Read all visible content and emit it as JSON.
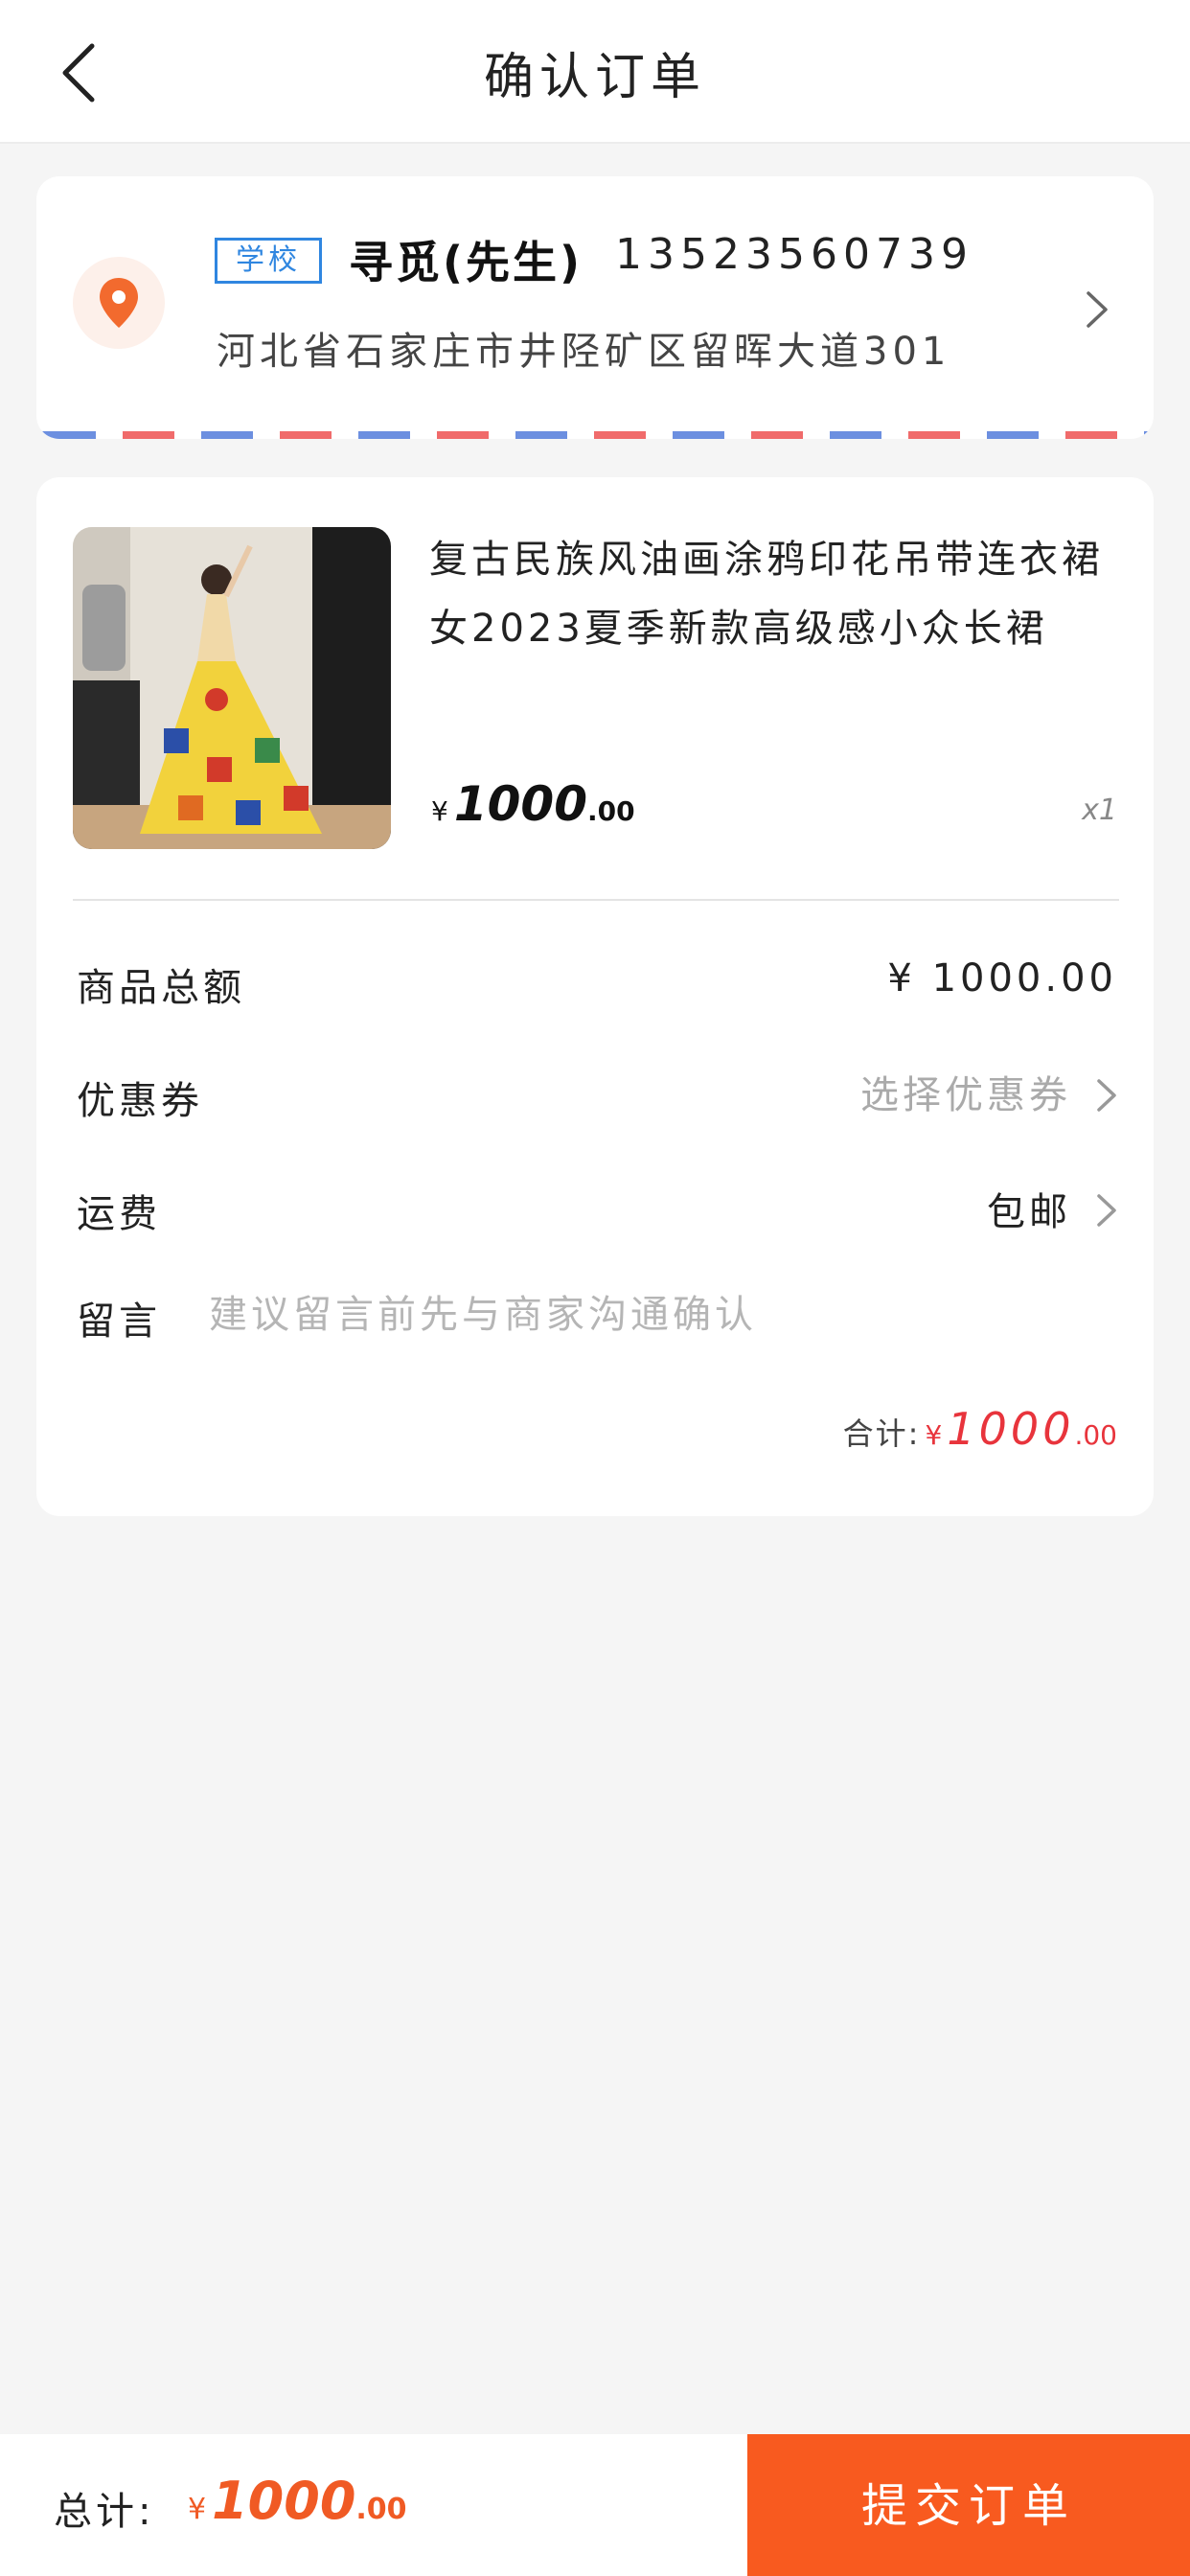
{
  "header": {
    "title": "确认订单"
  },
  "address": {
    "tag": "学校",
    "name": "寻觅(先生)",
    "phone": "13523560739",
    "detail": "河北省石家庄市井陉矿区留晖大道301"
  },
  "product": {
    "title": "复古民族风油画涂鸦印花吊带连衣裙女2023夏季新款高级感小众长裙",
    "price_currency": "¥",
    "price_int": "1000",
    "price_dec": ".00",
    "quantity": "x1"
  },
  "summary": {
    "goods_total_label": "商品总额",
    "goods_total_value": "¥ 1000.00",
    "coupon_label": "优惠券",
    "coupon_value": "选择优惠券",
    "shipping_label": "运费",
    "shipping_value": "包邮",
    "message_label": "留言",
    "message_placeholder": "建议留言前先与商家沟通确认",
    "subtotal_label": "合计:",
    "subtotal_currency": "¥",
    "subtotal_int": "1000",
    "subtotal_dec": ".00"
  },
  "bottom_bar": {
    "total_label": "总计:",
    "total_currency": "¥",
    "total_int": "1000",
    "total_dec": ".00",
    "submit_label": "提交订单"
  },
  "colors": {
    "accent": "#f85a1f",
    "price_red": "#e8343c",
    "tag_blue": "#2f86e0",
    "location_orange": "#f26a2e"
  },
  "icons": {
    "back": "chevron-left-icon",
    "location": "location-pin-icon",
    "chevron": "chevron-right-icon"
  }
}
